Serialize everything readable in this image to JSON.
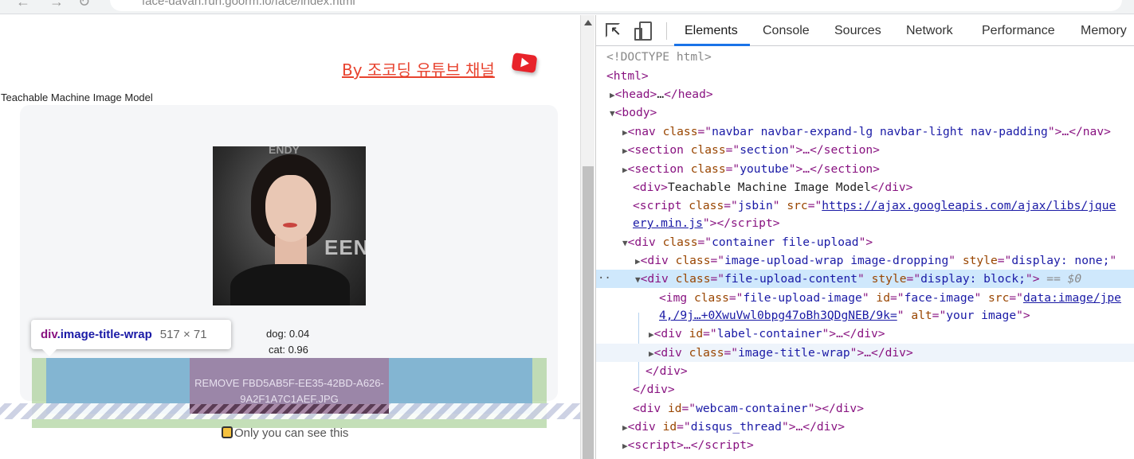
{
  "browser": {
    "url_host": "face-davan.run.goorm.io",
    "url_path": "/face/index.html"
  },
  "page": {
    "youtube_link": "By 조코딩 유튜브 채널",
    "model_title": "Teachable Machine Image Model",
    "image_alt": "your image",
    "label_dog": "dog: 0.04",
    "label_cat": "cat: 0.96",
    "predictions": [
      {
        "label": "dog",
        "value": 0.04
      },
      {
        "label": "cat",
        "value": 0.96
      }
    ],
    "remove_button": "REMOVE FBD5AB5F-EE35-42BD-A626-9A2F1A7C1AEF.JPG",
    "only_you_text": "Only you can see this"
  },
  "tooltip": {
    "tag": "div",
    "class": ".image-title-wrap",
    "dims": "517 × 71"
  },
  "devtools": {
    "tabs": [
      "Elements",
      "Console",
      "Sources",
      "Network",
      "Performance",
      "Memory"
    ],
    "active_tab": "Elements",
    "dom": {
      "doctype": "<!DOCTYPE html>",
      "html": "<html>",
      "head": [
        "<head>",
        "…",
        "</head>"
      ],
      "body": "<body>",
      "nav": {
        "attr": "navbar navbar-expand-lg navbar-light nav-padding",
        "close": "…</nav>"
      },
      "section1": "section",
      "section2": "youtube",
      "div_text": "Teachable Machine Image Model",
      "script_class": "jsbin",
      "script_src_1": "https://ajax.googleapis.com/ajax/libs/jque",
      "script_src_2": "ery.min.js",
      "container_class": "container file-upload",
      "wrap_class": "image-upload-wrap image-dropping",
      "wrap_style": "display: none;",
      "content_class": "file-upload-content",
      "content_style": "display: block;",
      "eq": "== $0",
      "img_class": "file-upload-image",
      "img_id": "face-image",
      "img_src_1": "data:image/jpe",
      "img_src_2": "4,/9j…+0XwuVwl0bpg47oBh3QDgNEB/9k=",
      "img_alt": "your image",
      "label_id": "label-container",
      "title_wrap_class": "image-title-wrap",
      "webcam_id": "webcam-container",
      "disqus_id": "disqus_thread"
    }
  },
  "colors": {
    "accent": "#1a73e8",
    "tag": "#881280",
    "attr": "#994500",
    "value": "#1a1aa6",
    "youtube": "#e8432f"
  }
}
